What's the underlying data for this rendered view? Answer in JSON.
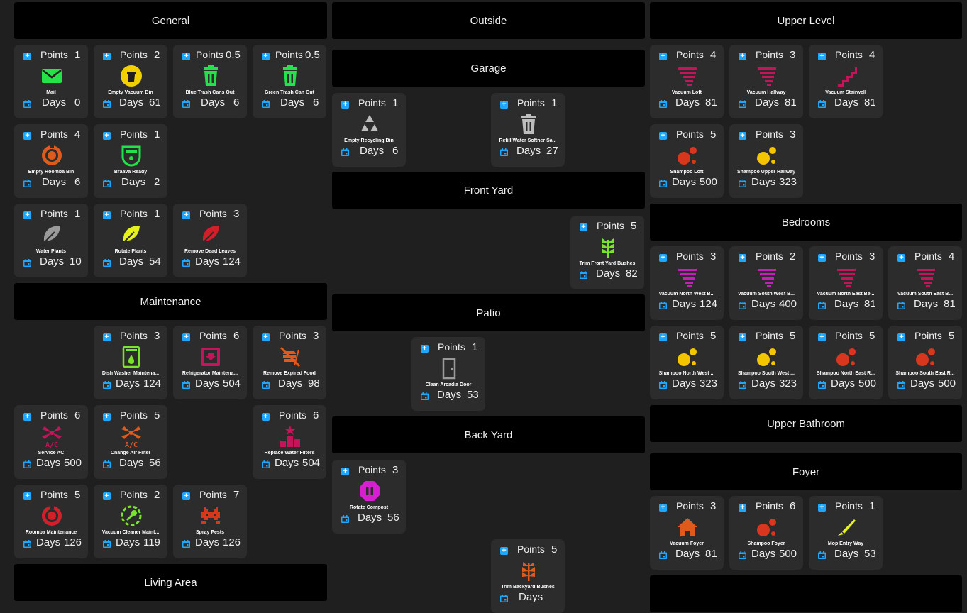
{
  "labels": {
    "points": "Points",
    "days": "Days"
  },
  "headers": {
    "general": "General",
    "outside": "Outside",
    "upper_level": "Upper Level",
    "garage": "Garage",
    "front_yard": "Front Yard",
    "bedrooms": "Bedrooms",
    "maintenance": "Maintenance",
    "patio": "Patio",
    "upper_bathroom": "Upper Bathroom",
    "back_yard": "Back Yard",
    "foyer": "Foyer",
    "living_area": "Living Area",
    "extra": ""
  },
  "chores": [
    {
      "name": "Mail",
      "points": "1",
      "days": "0",
      "icon": "mail-icon",
      "color": "#22e34a"
    },
    {
      "name": "Empty Vacuum Bin",
      "points": "2",
      "days": "61",
      "icon": "trash-can-icon",
      "color": "#f2d000"
    },
    {
      "name": "Blue Trash Cans Out",
      "points": "0.5",
      "days": "6",
      "icon": "trash-bin-icon",
      "color": "#22e34a"
    },
    {
      "name": "Green Trash Can Out",
      "points": "0.5",
      "days": "6",
      "icon": "trash-bin-icon",
      "color": "#22e34a"
    },
    {
      "name": "Empty Roomba Bin",
      "points": "4",
      "days": "6",
      "icon": "robot-vacuum-icon",
      "color": "#e05a1c"
    },
    {
      "name": "Braava Ready",
      "points": "1",
      "days": "2",
      "icon": "mop-robot-icon",
      "color": "#22e34a"
    },
    {
      "name": "Water Plants",
      "points": "1",
      "days": "10",
      "icon": "leaf-icon",
      "color": "#9a9a9a"
    },
    {
      "name": "Rotate Plants",
      "points": "1",
      "days": "54",
      "icon": "leaf-icon",
      "color": "#e6f21a"
    },
    {
      "name": "Remove Dead Leaves",
      "points": "3",
      "days": "124",
      "icon": "leaf-icon",
      "color": "#d21f2a"
    },
    {
      "name": "Empty Recycling Bin",
      "points": "1",
      "days": "6",
      "icon": "recycle-icon",
      "color": "#bdbdbd"
    },
    {
      "name": "Refill Water Softner Sa...",
      "points": "1",
      "days": "27",
      "icon": "trash-bin-icon",
      "color": "#bdbdbd"
    },
    {
      "name": "Trim Front Yard Bushes",
      "points": "5",
      "days": "82",
      "icon": "sprout-icon",
      "color": "#7be32a"
    },
    {
      "name": "Vacuum Loft",
      "points": "4",
      "days": "81",
      "icon": "tornado-icon",
      "color": "#c4155a"
    },
    {
      "name": "Vacuum Hallway",
      "points": "3",
      "days": "81",
      "icon": "tornado-icon",
      "color": "#c4155a"
    },
    {
      "name": "Vacuum Stairwell",
      "points": "4",
      "days": "81",
      "icon": "stairs-icon",
      "color": "#c4155a"
    },
    {
      "name": "Shampoo Loft",
      "points": "5",
      "days": "500",
      "icon": "bubbles-icon",
      "color": "#d9361e"
    },
    {
      "name": "Shampoo Upper Hallway",
      "points": "3",
      "days": "323",
      "icon": "bubbles-icon",
      "color": "#f2c500"
    },
    {
      "name": "Vacuum North West B...",
      "points": "3",
      "days": "124",
      "icon": "tornado-icon",
      "color": "#c41fb8"
    },
    {
      "name": "Vacuum South West B...",
      "points": "2",
      "days": "400",
      "icon": "tornado-icon",
      "color": "#c41fb8"
    },
    {
      "name": "Vacuum North East Be...",
      "points": "3",
      "days": "81",
      "icon": "tornado-icon",
      "color": "#c4155a"
    },
    {
      "name": "Vacuum South East B...",
      "points": "4",
      "days": "81",
      "icon": "tornado-icon",
      "color": "#c4155a"
    },
    {
      "name": "Shampoo North West ...",
      "points": "5",
      "days": "323",
      "icon": "bubbles-icon",
      "color": "#f2c500"
    },
    {
      "name": "Shampoo South West ...",
      "points": "5",
      "days": "323",
      "icon": "bubbles-icon",
      "color": "#f2c500"
    },
    {
      "name": "Shampoo North East R...",
      "points": "5",
      "days": "500",
      "icon": "bubbles-icon",
      "color": "#d9361e"
    },
    {
      "name": "Shampoo South East R...",
      "points": "5",
      "days": "500",
      "icon": "bubbles-icon",
      "color": "#d9361e"
    },
    {
      "name": "Dish Washer Maintena...",
      "points": "3",
      "days": "124",
      "icon": "washer-icon",
      "color": "#7be32a"
    },
    {
      "name": "Refrigerator Maintena...",
      "points": "6",
      "days": "504",
      "icon": "fridge-tray-icon",
      "color": "#c4155a"
    },
    {
      "name": "Remove Expired Food",
      "points": "3",
      "days": "98",
      "icon": "no-food-icon",
      "color": "#e05a1c"
    },
    {
      "name": "Clean Arcadia Door",
      "points": "1",
      "days": "53",
      "icon": "door-icon",
      "color": "#9a9a9a"
    },
    {
      "name": "Service AC",
      "points": "6",
      "days": "500",
      "icon": "ac-fan-icon",
      "color": "#c4155a"
    },
    {
      "name": "Change Air Filter",
      "points": "5",
      "days": "56",
      "icon": "ac-fan-icon",
      "color": "#e05a1c"
    },
    {
      "name": "Replace Water Filters",
      "points": "6",
      "days": "504",
      "icon": "filter-podium-icon",
      "color": "#c4155a"
    },
    {
      "name": "Rotate Compost",
      "points": "3",
      "days": "56",
      "icon": "pause-octagon-icon",
      "color": "#d81fd0"
    },
    {
      "name": "Roomba Maintenance",
      "points": "5",
      "days": "126",
      "icon": "robot-vacuum-icon",
      "color": "#d21f2a"
    },
    {
      "name": "Vacuum Cleaner Maint...",
      "points": "2",
      "days": "119",
      "icon": "wrench-circle-icon",
      "color": "#7be32a"
    },
    {
      "name": "Spray Pests",
      "points": "7",
      "days": "126",
      "icon": "invader-icon",
      "color": "#d9361e"
    },
    {
      "name": "Vacuum Foyer",
      "points": "3",
      "days": "81",
      "icon": "home-icon",
      "color": "#e05a1c"
    },
    {
      "name": "Shampoo Foyer",
      "points": "6",
      "days": "500",
      "icon": "bubbles-icon",
      "color": "#d9361e"
    },
    {
      "name": "Mop Entry Way",
      "points": "1",
      "days": "53",
      "icon": "brush-icon",
      "color": "#e6f21a"
    },
    {
      "name": "Trim Backyard Bushes",
      "points": "5",
      "days": "",
      "icon": "sprout-icon",
      "color": "#e05a1c"
    }
  ]
}
